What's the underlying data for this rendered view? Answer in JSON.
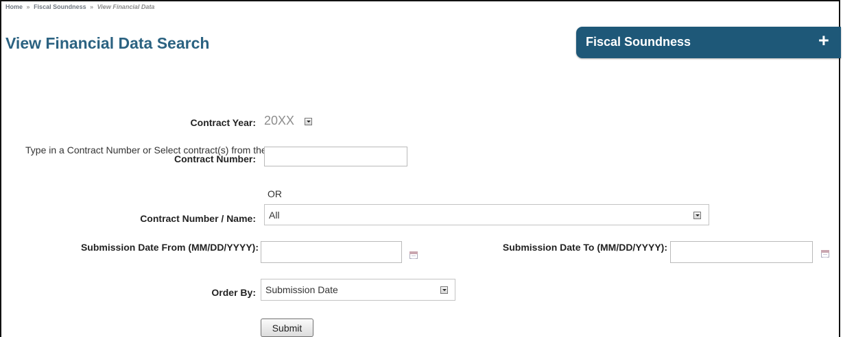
{
  "breadcrumb": {
    "home": "Home",
    "separator": "»",
    "section": "Fiscal Soundness",
    "current": "View Financial Data"
  },
  "page_title": "View Financial Data Search",
  "side_panel": {
    "title": "Fiscal Soundness",
    "expand_icon": "plus-icon",
    "color": "#1e5878"
  },
  "form": {
    "contract_year": {
      "label": "Contract Year:",
      "value": "20XX"
    },
    "instructions": "Type in a Contract Number or Select contract(s) from the Contract Number/Name List",
    "contract_number": {
      "label": "Contract Number:",
      "value": ""
    },
    "or_text": "OR",
    "contract_name": {
      "label": "Contract Number / Name:",
      "value": "All"
    },
    "date_from": {
      "label": "Submission Date From (MM/DD/YYYY):",
      "value": ""
    },
    "date_to": {
      "label": "Submission Date To (MM/DD/YYYY):",
      "value": ""
    },
    "order_by": {
      "label": "Order By:",
      "value": "Submission Date"
    },
    "submit_label": "Submit"
  },
  "colors": {
    "title": "#2b6281",
    "panel": "#1e5878"
  }
}
